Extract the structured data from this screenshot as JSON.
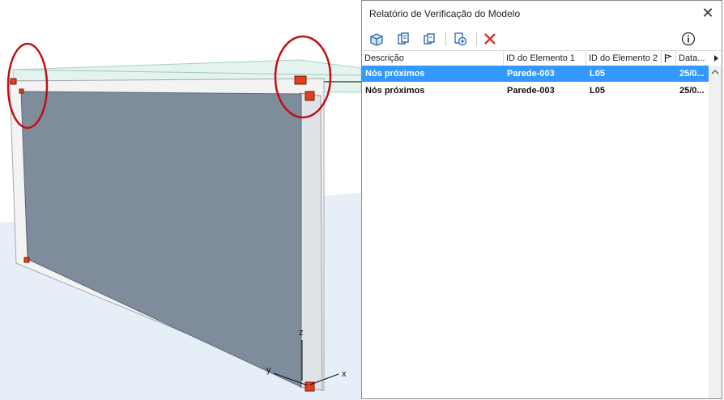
{
  "viewport": {
    "axis_labels": {
      "x": "x",
      "y": "y",
      "z": "z"
    },
    "colors": {
      "wall_face": "#7f8c9c",
      "highlight_circle": "#c0101a",
      "node_marker": "#e0401a"
    }
  },
  "dialog": {
    "title": "Relatório de Verificação do Modelo",
    "toolbar_icons": [
      "highlight-in-model-icon",
      "select-element-1-icon",
      "select-element-2-icon",
      "add-to-report-icon",
      "delete-icon",
      "info-icon"
    ],
    "columns": {
      "descricao": "Descrição",
      "id_elemento_1": "ID do Elemento 1",
      "id_elemento_2": "ID do Elemento 2",
      "flag": "flag-icon",
      "data": "Data..."
    },
    "rows": [
      {
        "descricao": "Nós próximos",
        "id1": "Parede-003",
        "id2": "L05",
        "data": "25/0...",
        "selected": true
      },
      {
        "descricao": "Nós próximos",
        "id1": "Parede-003",
        "id2": "L05",
        "data": "25/0...",
        "selected": false
      }
    ],
    "colors": {
      "selection": "#3399ff",
      "delete_icon": "#e03020",
      "toolbar_icon": "#1a5fa8"
    }
  }
}
